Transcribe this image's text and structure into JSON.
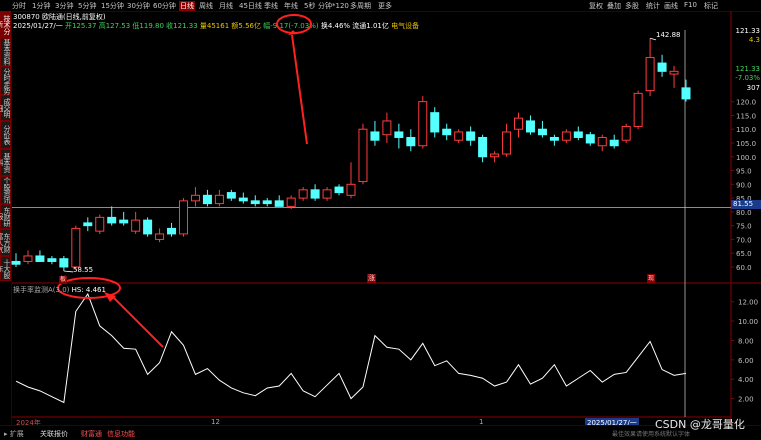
{
  "top_tabs": [
    "分时",
    "1分钟",
    "3分钟",
    "5分钟",
    "15分钟",
    "30分钟",
    "60分钟",
    "日线",
    "周线",
    "月线",
    "45日线",
    "季线",
    "年线",
    "5秒",
    "分钟*120",
    "多周期",
    "更多"
  ],
  "active_tab": "日线",
  "top_right_tabs": [
    "复权",
    "叠加",
    "多股",
    "统计",
    "画线",
    "F10",
    "标记"
  ],
  "left_tabs": [
    "技术分析",
    "基本资料",
    "分时走势",
    "成交明细",
    "分价表",
    "基本资料",
    "个股资讯",
    "东财研报",
    "东方财富人气",
    "十大股东"
  ],
  "left_active": "技术分析",
  "stock": {
    "code_name": "300870 欧陆通(日线,前复权)",
    "date": "2025/01/27/一",
    "open_label": "开",
    "open": "125.37",
    "high_label": "高",
    "high": "127.53",
    "low_label": "低",
    "low": "119.80",
    "close_label": "收",
    "close": "121.33",
    "vol_label": "量",
    "vol": "45161",
    "amount_label": "额",
    "amount": "5.56亿",
    "change_label": "幅",
    "change": "-9.17(-7.03%)",
    "turnover_label": "换",
    "turnover": "4.46%",
    "flow_label": "流通",
    "flow": "1.01亿",
    "sector": "电气设备"
  },
  "price_axis": [
    "120.0",
    "115.0",
    "110.0",
    "105.0",
    "100.0",
    "95.0",
    "90.0",
    "85.0",
    "80.0",
    "75.0",
    "70.0",
    "65.0",
    "60.0"
  ],
  "price_right_top": [
    "121.33",
    "4.3",
    "121.33",
    "-7.03%",
    "307"
  ],
  "crosshair_price": "81.55",
  "max_label": "142.88",
  "min_label": "58.55",
  "marker_zhang": "涨",
  "marker_ban": "板",
  "marker_ban2": "现",
  "indicator": {
    "name": "换手率监测A(3,0)",
    "value_label": "HS: 4.461"
  },
  "indicator_axis": [
    "12.00",
    "10.00",
    "8.00",
    "6.00",
    "4.00",
    "2.00"
  ],
  "x_axis_labels": [
    "2024年",
    "12",
    "1",
    "2025/01/27/一"
  ],
  "bottom_tabs": [
    "扩展",
    "关联报价",
    "财富通",
    "信息功能"
  ],
  "watermark": "CSDN @龙哥量化",
  "footer_right": "最佳效果请使用系统默认字体",
  "colors": {
    "up": "#ff3c3c",
    "down": "#54ffff",
    "line": "#ffffff",
    "accent": "#8a0000"
  },
  "chart_data": {
    "type": "candlestick",
    "ylim": [
      56,
      146
    ],
    "candles": [
      {
        "o": 62,
        "h": 65,
        "l": 60,
        "c": 61
      },
      {
        "o": 62,
        "h": 66,
        "l": 61,
        "c": 64
      },
      {
        "o": 64,
        "h": 66,
        "l": 62,
        "c": 62
      },
      {
        "o": 63,
        "h": 64,
        "l": 61,
        "c": 62
      },
      {
        "o": 63,
        "h": 64,
        "l": 58.55,
        "c": 60
      },
      {
        "o": 60,
        "h": 75,
        "l": 59,
        "c": 74
      },
      {
        "o": 76,
        "h": 78,
        "l": 73,
        "c": 75
      },
      {
        "o": 73,
        "h": 79,
        "l": 72,
        "c": 78
      },
      {
        "o": 78,
        "h": 82,
        "l": 75,
        "c": 76
      },
      {
        "o": 77,
        "h": 80,
        "l": 75,
        "c": 76
      },
      {
        "o": 73,
        "h": 80,
        "l": 72,
        "c": 77
      },
      {
        "o": 77,
        "h": 78,
        "l": 71,
        "c": 72
      },
      {
        "o": 70,
        "h": 74,
        "l": 69,
        "c": 72
      },
      {
        "o": 74,
        "h": 76,
        "l": 71,
        "c": 72
      },
      {
        "o": 72,
        "h": 85,
        "l": 71,
        "c": 84
      },
      {
        "o": 84,
        "h": 89,
        "l": 82,
        "c": 86
      },
      {
        "o": 86,
        "h": 88,
        "l": 82,
        "c": 83
      },
      {
        "o": 83,
        "h": 88,
        "l": 82,
        "c": 86
      },
      {
        "o": 87,
        "h": 88,
        "l": 84,
        "c": 85
      },
      {
        "o": 85,
        "h": 87,
        "l": 83,
        "c": 84
      },
      {
        "o": 84,
        "h": 86,
        "l": 82,
        "c": 83
      },
      {
        "o": 84,
        "h": 85,
        "l": 82,
        "c": 83
      },
      {
        "o": 84,
        "h": 86,
        "l": 82,
        "c": 82
      },
      {
        "o": 82,
        "h": 86,
        "l": 81,
        "c": 85
      },
      {
        "o": 85,
        "h": 89,
        "l": 84,
        "c": 88
      },
      {
        "o": 88,
        "h": 90,
        "l": 84,
        "c": 85
      },
      {
        "o": 85,
        "h": 89,
        "l": 84,
        "c": 88
      },
      {
        "o": 89,
        "h": 90,
        "l": 86,
        "c": 87
      },
      {
        "o": 86,
        "h": 98,
        "l": 85,
        "c": 90
      },
      {
        "o": 91,
        "h": 112,
        "l": 90,
        "c": 110
      },
      {
        "o": 109,
        "h": 113,
        "l": 104,
        "c": 106
      },
      {
        "o": 108,
        "h": 116,
        "l": 105,
        "c": 113
      },
      {
        "o": 109,
        "h": 112,
        "l": 103,
        "c": 107
      },
      {
        "o": 107,
        "h": 110,
        "l": 102,
        "c": 104
      },
      {
        "o": 104,
        "h": 122,
        "l": 103,
        "c": 120
      },
      {
        "o": 116,
        "h": 118,
        "l": 107,
        "c": 109
      },
      {
        "o": 110,
        "h": 112,
        "l": 106,
        "c": 108
      },
      {
        "o": 106,
        "h": 110,
        "l": 105,
        "c": 109
      },
      {
        "o": 109,
        "h": 111,
        "l": 104,
        "c": 106
      },
      {
        "o": 107,
        "h": 108,
        "l": 98,
        "c": 100
      },
      {
        "o": 100,
        "h": 102,
        "l": 98,
        "c": 101
      },
      {
        "o": 101,
        "h": 112,
        "l": 100,
        "c": 109
      },
      {
        "o": 110,
        "h": 116,
        "l": 107,
        "c": 114
      },
      {
        "o": 113,
        "h": 115,
        "l": 108,
        "c": 109
      },
      {
        "o": 110,
        "h": 113,
        "l": 107,
        "c": 108
      },
      {
        "o": 107,
        "h": 108,
        "l": 104,
        "c": 106
      },
      {
        "o": 106,
        "h": 110,
        "l": 105,
        "c": 109
      },
      {
        "o": 109,
        "h": 111,
        "l": 106,
        "c": 107
      },
      {
        "o": 108,
        "h": 109,
        "l": 104,
        "c": 105
      },
      {
        "o": 104,
        "h": 108,
        "l": 102,
        "c": 107
      },
      {
        "o": 106,
        "h": 108,
        "l": 103,
        "c": 104
      },
      {
        "o": 106,
        "h": 112,
        "l": 105,
        "c": 111
      },
      {
        "o": 111,
        "h": 124,
        "l": 110,
        "c": 123
      },
      {
        "o": 124,
        "h": 143,
        "l": 122,
        "c": 136
      },
      {
        "o": 134,
        "h": 137,
        "l": 129,
        "c": 131
      },
      {
        "o": 130,
        "h": 133,
        "l": 125,
        "c": 131
      },
      {
        "o": 125,
        "h": 128,
        "l": 120,
        "c": 121
      }
    ],
    "indicator_values": [
      3.8,
      3.2,
      2.8,
      2.2,
      1.6,
      11.0,
      12.8,
      9.5,
      8.5,
      7.2,
      7.1,
      4.5,
      5.7,
      8.9,
      7.5,
      4.5,
      5.1,
      3.9,
      3.1,
      2.6,
      2.3,
      3.1,
      3.3,
      4.6,
      2.8,
      2.2,
      3.4,
      4.6,
      2.0,
      3.2,
      8.5,
      7.3,
      7.1,
      6.0,
      7.7,
      5.4,
      5.9,
      4.6,
      4.4,
      4.1,
      3.3,
      3.7,
      5.5,
      3.5,
      4.1,
      5.5,
      3.3,
      4.1,
      4.9,
      3.7,
      4.5,
      4.7,
      6.3,
      7.9,
      5.0,
      4.4,
      4.6
    ],
    "indicator_ylim": [
      0,
      13
    ]
  }
}
